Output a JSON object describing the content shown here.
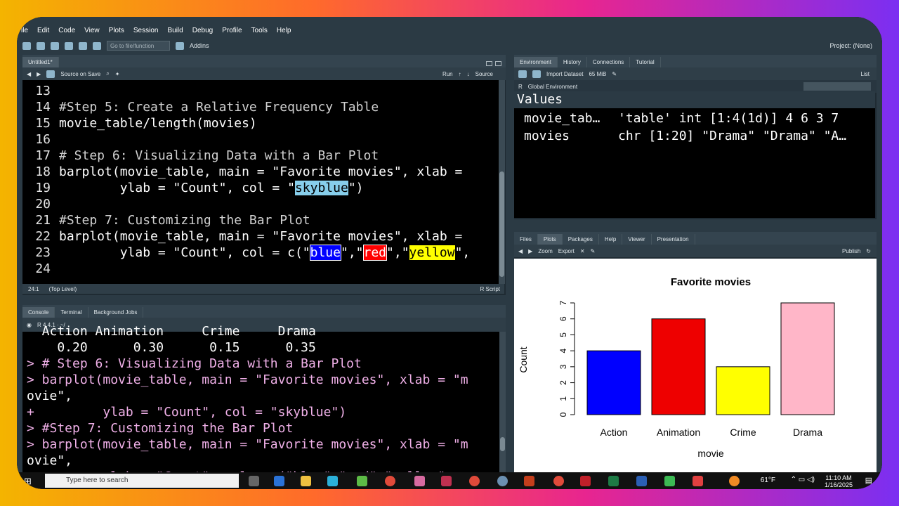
{
  "menu": [
    "ile",
    "Edit",
    "Code",
    "View",
    "Plots",
    "Session",
    "Build",
    "Debug",
    "Profile",
    "Tools",
    "Help"
  ],
  "toolbar": {
    "goto_placeholder": "Go to file/function",
    "addins": "Addins",
    "project": "Project: (None)"
  },
  "editor": {
    "tab": "Untitled1*",
    "source_on_save": "Source on Save",
    "run": "Run",
    "source": "Source",
    "lines": [
      {
        "n": "13",
        "text": ""
      },
      {
        "n": "14",
        "text": "#Step 5: Create a Relative Frequency Table"
      },
      {
        "n": "15",
        "text": "movie_table/length(movies)"
      },
      {
        "n": "16",
        "text": ""
      },
      {
        "n": "17",
        "text": "# Step 6: Visualizing Data with a Bar Plot"
      },
      {
        "n": "18",
        "text": "barplot(movie_table, main = \"Favorite movies\", xlab ="
      },
      {
        "n": "19",
        "a": "        ylab = \"Count\", col = \"",
        "hl": "skyblue",
        "b": "\")"
      },
      {
        "n": "20",
        "text": ""
      },
      {
        "n": "21",
        "text": "#Step 7: Customizing the Bar Plot"
      },
      {
        "n": "22",
        "text": "barplot(movie_table, main = \"Favorite movies\", xlab ="
      },
      {
        "n": "23",
        "a": "        ylab = \"Count\", col = c(\"",
        "h1": "blue",
        "m1": "\",\"",
        "h2": "red",
        "m2": "\",\"",
        "h3": "yellow",
        "b": "\","
      },
      {
        "n": "24",
        "text": ""
      }
    ],
    "status_pos": "24:1",
    "status_level": "(Top Level)",
    "status_type": "R Script"
  },
  "console": {
    "tabs": [
      "Console",
      "Terminal",
      "Background Jobs"
    ],
    "rversion": "R 4.4.1 · ~/",
    "lines": [
      "  Action Animation     Crime     Drama",
      "    0.20      0.30      0.15      0.35",
      "> # Step 6: Visualizing Data with a Bar Plot",
      "> barplot(movie_table, main = \"Favorite movies\", xlab = \"m",
      "ovie\",",
      "+         ylab = \"Count\", col = \"skyblue\")",
      "> #Step 7: Customizing the Bar Plot",
      "> barplot(movie_table, main = \"Favorite movies\", xlab = \"m",
      "ovie\",",
      "+         ylab = \"Count\", col = c(\"blue\",\"red\",\"yellow\","
    ]
  },
  "environment": {
    "tabs": [
      "Environment",
      "History",
      "Connections",
      "Tutorial"
    ],
    "import": "Import Dataset",
    "mem": "65 MiB",
    "list": "List",
    "lang": "R",
    "scope": "Global Environment",
    "section": "Values",
    "rows": [
      {
        "name": "movie_tab…",
        "value": "'table' int [1:4(1d)] 4 6 3 7"
      },
      {
        "name": "movies",
        "value": "chr [1:20] \"Drama\" \"Drama\" \"A…"
      }
    ]
  },
  "plots": {
    "tabs": [
      "Files",
      "Plots",
      "Packages",
      "Help",
      "Viewer",
      "Presentation"
    ],
    "zoom": "Zoom",
    "export": "Export",
    "publish": "Publish"
  },
  "chart_data": {
    "type": "bar",
    "title": "Favorite movies",
    "xlabel": "movie",
    "ylabel": "Count",
    "categories": [
      "Action",
      "Animation",
      "Crime",
      "Drama"
    ],
    "values": [
      4,
      6,
      3,
      7
    ],
    "colors": [
      "#0000ff",
      "#ee0000",
      "#ffff00",
      "#ffb6c8"
    ],
    "ylim": [
      0,
      7
    ],
    "yticks": [
      "0",
      "1",
      "2",
      "3",
      "4",
      "5",
      "6",
      "7"
    ]
  },
  "taskbar": {
    "search": "Type here to search",
    "weather": "61°F",
    "time": "11:10 AM",
    "date": "1/16/2025"
  }
}
